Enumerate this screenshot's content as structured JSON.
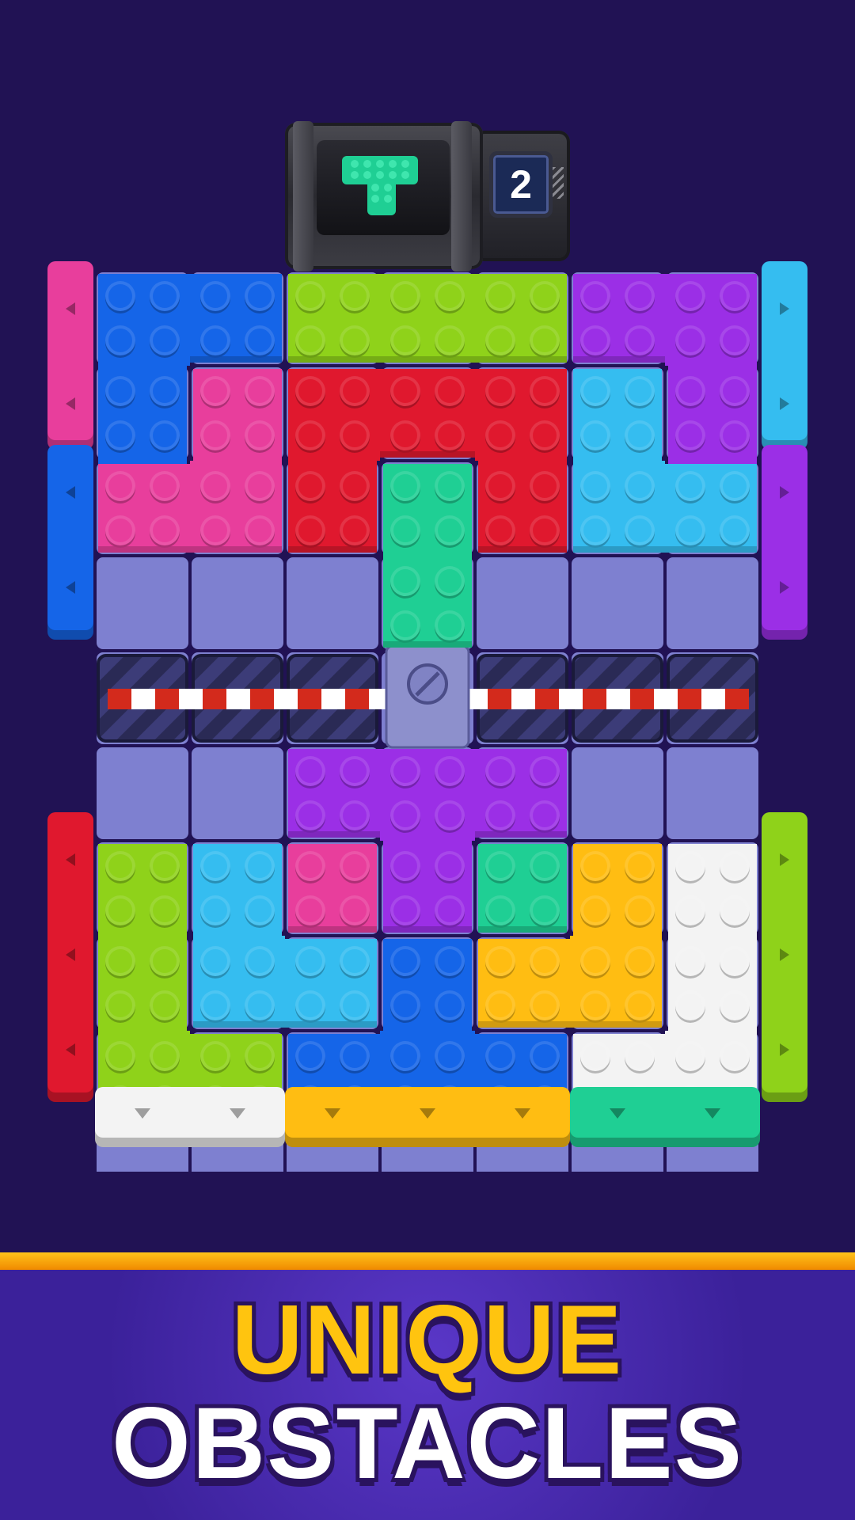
{
  "dispenser": {
    "piece": "T-shaped teal block",
    "piece_color": "#1fcf94",
    "remaining_count": "2"
  },
  "board": {
    "background_color": "#211254",
    "cell_color": "#7e80d0",
    "colors": {
      "blue": "#1565e8",
      "lime": "#8fd21a",
      "purple": "#9b2fe6",
      "pink": "#e83e9c",
      "red": "#e0182e",
      "teal": "#1fcf94",
      "cyan": "#35bdf0",
      "yellow": "#ffbd12",
      "white": "#f3f3f3"
    },
    "obstacle": "striped barrier",
    "barrier_colors": [
      "#d32a1c",
      "#ffffff"
    ]
  },
  "banner": {
    "line1": "UNIQUE",
    "line2": "OBSTACLES",
    "line1_color": "#ffc40f",
    "line2_color": "#ffffff"
  }
}
